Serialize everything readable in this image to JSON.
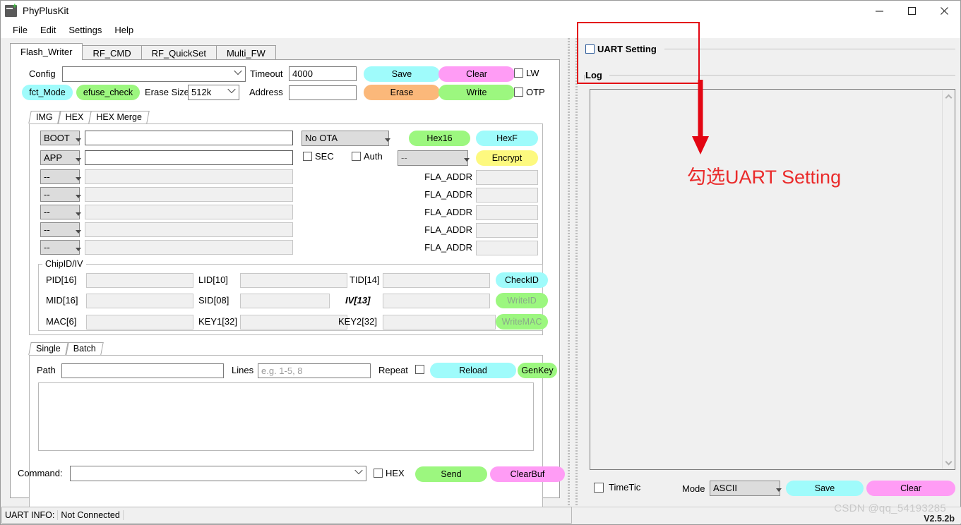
{
  "window": {
    "title": "PhyPlusKit",
    "icon": "app-icon",
    "minimize": "—",
    "maximize": "□",
    "close": "✕"
  },
  "menu": {
    "items": [
      "File",
      "Edit",
      "Settings",
      "Help"
    ]
  },
  "tabs": {
    "items": [
      "Flash_Writer",
      "RF_CMD",
      "RF_QuickSet",
      "Multi_FW"
    ],
    "active": "Flash_Writer"
  },
  "toolbar": {
    "config_label": "Config",
    "config_value": "",
    "timeout_label": "Timeout",
    "timeout_value": "4000",
    "save_label": "Save",
    "clear_label": "Clear",
    "lw_label": "LW",
    "fct_mode_label": "fct_Mode",
    "efuse_check_label": "efuse_check",
    "erase_size_label": "Erase Size",
    "erase_size_value": "512k",
    "address_label": "Address",
    "address_value": "",
    "erase_label": "Erase",
    "write_label": "Write",
    "otp_label": "OTP"
  },
  "hex_tabs": {
    "items": [
      "IMG",
      "HEX",
      "HEX Merge"
    ],
    "active": "HEX Merge"
  },
  "hex_merge": {
    "rows": [
      {
        "select": "BOOT",
        "path": "",
        "enabled": true
      },
      {
        "select": "APP",
        "path": "",
        "enabled": true
      },
      {
        "select": "--",
        "path": "",
        "enabled": false
      },
      {
        "select": "--",
        "path": "",
        "enabled": false
      },
      {
        "select": "--",
        "path": "",
        "enabled": false
      },
      {
        "select": "--",
        "path": "",
        "enabled": false
      },
      {
        "select": "--",
        "path": "",
        "enabled": false
      }
    ],
    "ota_value": "No OTA",
    "sec_label": "SEC",
    "auth_label": "Auth",
    "enc_select_value": "--",
    "hex16_label": "Hex16",
    "hexf_label": "HexF",
    "encrypt_label": "Encrypt",
    "fla_addr_label": "FLA_ADDR",
    "fla_addr_values": [
      "",
      "",
      "",
      "",
      ""
    ]
  },
  "chipid": {
    "group_title": "ChipID/IV",
    "fields": [
      {
        "label": "PID[16]",
        "value": ""
      },
      {
        "label": "LID[10]",
        "value": ""
      },
      {
        "label": "TID[14]",
        "value": ""
      },
      {
        "label": "MID[16]",
        "value": ""
      },
      {
        "label": "SID[08]",
        "value": ""
      },
      {
        "label": "IV[13]",
        "value": ""
      },
      {
        "label": "MAC[6]",
        "value": ""
      },
      {
        "label": "KEY1[32]",
        "value": ""
      },
      {
        "label": "KEY2[32]",
        "value": ""
      }
    ],
    "check_id_label": "CheckID",
    "write_id_label": "WriteID",
    "write_mac_label": "WriteMAC"
  },
  "batch": {
    "tabs": [
      "Single",
      "Batch"
    ],
    "active": "Batch",
    "path_label": "Path",
    "path_value": "",
    "lines_label": "Lines",
    "lines_placeholder": "e.g. 1-5, 8",
    "repeat_label": "Repeat",
    "reload_label": "Reload",
    "genkey_label": "GenKey",
    "list_content": ""
  },
  "command": {
    "label": "Command:",
    "value": "",
    "hex_label": "HEX",
    "send_label": "Send",
    "clearbuf_label": "ClearBuf"
  },
  "right_panel": {
    "uart_setting_label": "UART Setting",
    "log_label": "Log",
    "log_content": "",
    "timetic_label": "TimeTic",
    "mode_label": "Mode",
    "mode_value": "ASCII",
    "save_label": "Save",
    "clear_label": "Clear"
  },
  "statusbar": {
    "uart_info_label": "UART INFO:",
    "uart_info_value": "Not Connected",
    "version": "V2.5.2b",
    "watermark": "CSDN @qq_54193285"
  },
  "annotation": {
    "text": "勾选UART Setting",
    "color": "#ea2b2b"
  },
  "colors": {
    "cyan": "#9ffbfb",
    "magenta": "#ff9cf5",
    "green": "#9cf77f",
    "orange": "#fbb87a",
    "yellow": "#fdf97f",
    "cyan_light": "#a0fbf9",
    "red": "#e30613"
  }
}
